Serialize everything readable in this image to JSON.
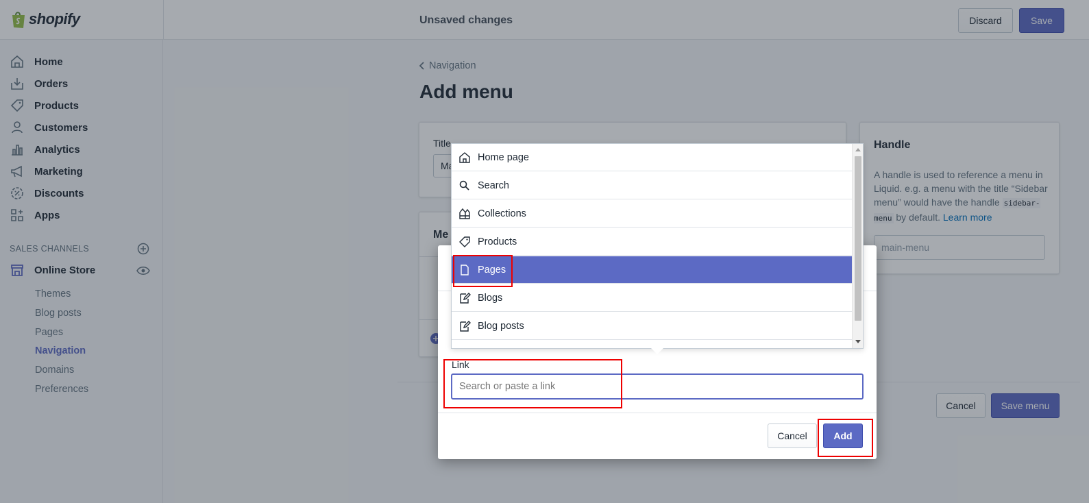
{
  "topbar": {
    "logo_text": "shopify",
    "status_text": "Unsaved changes",
    "discard_label": "Discard",
    "save_label": "Save"
  },
  "sidebar": {
    "items": [
      {
        "label": "Home",
        "icon": "home-icon"
      },
      {
        "label": "Orders",
        "icon": "orders-icon"
      },
      {
        "label": "Products",
        "icon": "tag-icon"
      },
      {
        "label": "Customers",
        "icon": "person-icon"
      },
      {
        "label": "Analytics",
        "icon": "bar-chart-icon"
      },
      {
        "label": "Marketing",
        "icon": "megaphone-icon"
      },
      {
        "label": "Discounts",
        "icon": "discount-icon"
      },
      {
        "label": "Apps",
        "icon": "apps-icon"
      }
    ],
    "sales_channels_label": "SALES CHANNELS",
    "online_store_label": "Online Store",
    "sub_items": [
      "Themes",
      "Blog posts",
      "Pages",
      "Navigation",
      "Domains",
      "Preferences"
    ],
    "active_sub_item": "Navigation"
  },
  "main": {
    "breadcrumb": "Navigation",
    "page_title": "Add menu",
    "title_label": "Title",
    "title_value": "Ma",
    "menu_items_heading": "Me",
    "cancel_label": "Cancel",
    "save_menu_label": "Save menu",
    "handle": {
      "heading": "Handle",
      "description_1": "A handle is used to reference a menu in Liquid. e.g. a menu with the title “Sidebar menu” would have the handle",
      "code": "sidebar-menu",
      "description_2": "by default.",
      "learn_more": "Learn more",
      "placeholder": "main-menu"
    }
  },
  "dropdown": {
    "items": [
      {
        "label": "Home page",
        "icon": "home-icon"
      },
      {
        "label": "Search",
        "icon": "search-icon"
      },
      {
        "label": "Collections",
        "icon": "collections-icon"
      },
      {
        "label": "Products",
        "icon": "tag-icon"
      },
      {
        "label": "Pages",
        "icon": "page-icon"
      },
      {
        "label": "Blogs",
        "icon": "blog-edit-icon"
      },
      {
        "label": "Blog posts",
        "icon": "blog-edit-icon"
      }
    ],
    "selected": "Pages"
  },
  "modal": {
    "link_label": "Link",
    "link_placeholder": "Search or paste a link",
    "cancel_label": "Cancel",
    "add_label": "Add"
  },
  "colors": {
    "accent": "#5c6ac4",
    "highlight": "#ee0000"
  }
}
